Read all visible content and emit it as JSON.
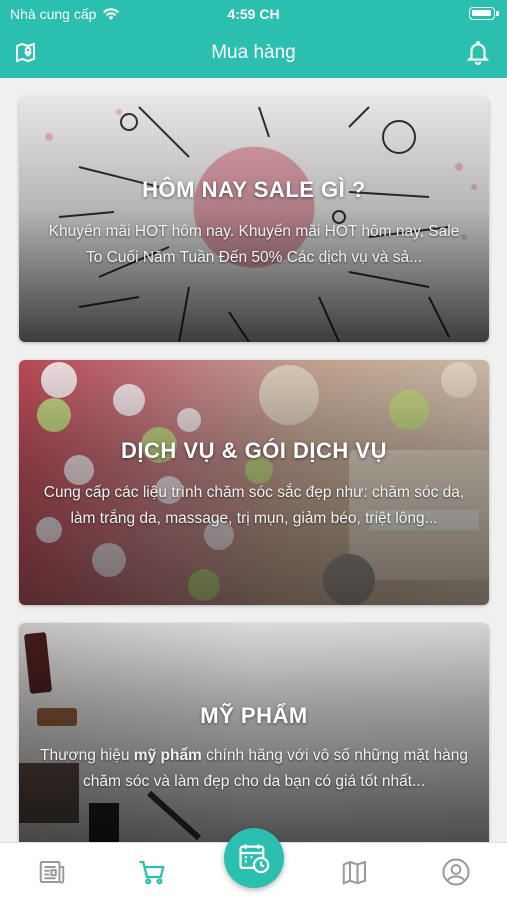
{
  "status_bar": {
    "carrier": "Nhà cung cấp",
    "time": "4:59 CH",
    "battery_level": 0.9
  },
  "nav": {
    "title": "Mua hàng",
    "left_icon": "map-pin-icon",
    "right_icon": "bell-icon"
  },
  "cards": [
    {
      "title": "HÔM NAY SALE GÌ ?",
      "description": "Khuyến mãi HOT hôm nay. Khuyến mãi HOT hôm nay, Sale To Cuối Năm Tuần Đến 50% Các dịch vụ và sả..."
    },
    {
      "title": "DỊCH VỤ & GÓI DỊCH VỤ",
      "description": "Cung cấp các liệu trình chăm sóc sắc đẹp như: chăm sóc da, làm trắng da, massage, trị mụn, giảm béo, triệt lông..."
    },
    {
      "title": "MỸ PHẨM",
      "description_before": "Thương hiệu ",
      "description_bold": "mỹ phẩm",
      "description_after": " chính hãng với vô số những mặt hàng chăm sóc và làm đẹp cho da bạn có giá tốt nhất..."
    }
  ],
  "tabbar": {
    "items": [
      "news-icon",
      "cart-icon",
      "calendar-clock-icon",
      "map-icon",
      "profile-icon"
    ],
    "active": "cart-icon",
    "accent": "#2bbfb0",
    "inactive": "#9a9a9a"
  }
}
